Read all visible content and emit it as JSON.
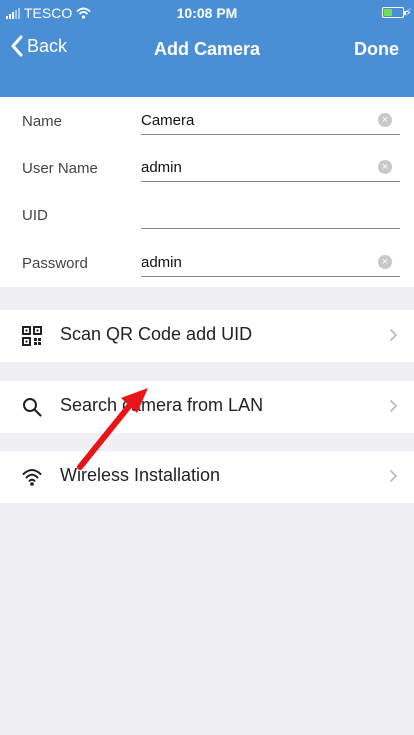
{
  "status": {
    "carrier": "TESCO",
    "time": "10:08 PM"
  },
  "nav": {
    "back_label": "Back",
    "title": "Add Camera",
    "done_label": "Done"
  },
  "form": {
    "name_label": "Name",
    "name_value": "Camera",
    "username_label": "User Name",
    "username_value": "admin",
    "uid_label": "UID",
    "uid_value": "",
    "password_label": "Password",
    "password_value": "admin"
  },
  "actions": {
    "scan_label": "Scan QR Code add UID",
    "search_label": "Search camera from LAN",
    "wireless_label": "Wireless Installation"
  },
  "colors": {
    "header": "#4a8fd6",
    "background": "#efeff4",
    "annotation_arrow": "#e8141a"
  }
}
